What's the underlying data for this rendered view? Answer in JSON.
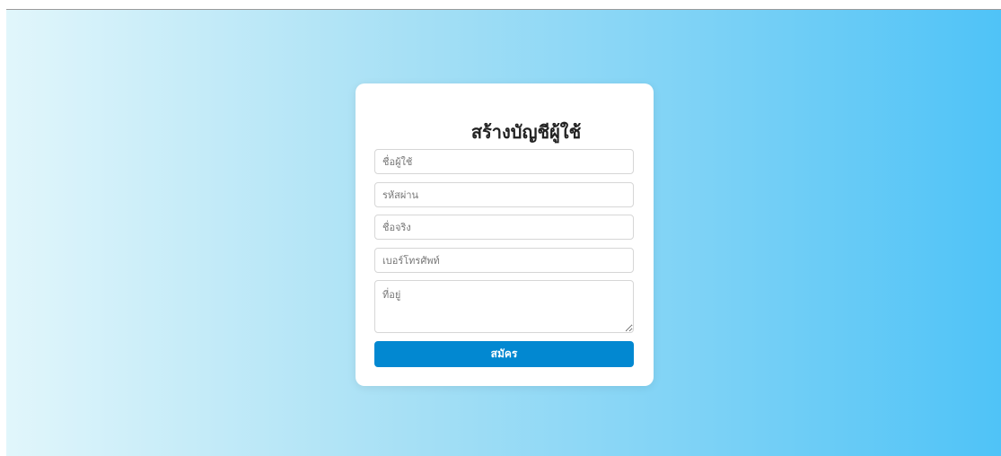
{
  "form": {
    "title": "สร้างบัญชีผู้ใช้",
    "username_placeholder": "ชื่อผู้ใช้",
    "password_placeholder": "รหัสผ่าน",
    "fullname_placeholder": "ชื่อจริง",
    "phone_placeholder": "เบอร์โทรศัพท์",
    "address_placeholder": "ที่อยู่",
    "submit_label": "สมัคร"
  },
  "colors": {
    "button": "#0288d1",
    "gradient_start": "#e1f6fb",
    "gradient_end": "#4fc3f7"
  }
}
